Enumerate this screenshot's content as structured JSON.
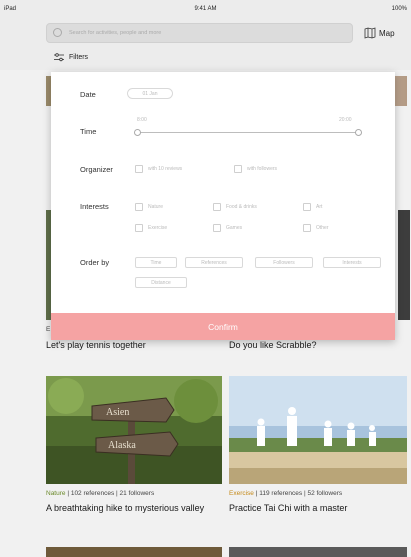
{
  "status_bar": {
    "carrier": "iPad",
    "time": "9:41 AM",
    "battery": "100%"
  },
  "search": {
    "placeholder": "Search for activities, people and more"
  },
  "map_button": {
    "label": "Map",
    "icon": "map-icon"
  },
  "filters_button": {
    "label": "Filters",
    "icon": "sliders-icon"
  },
  "filters": {
    "date": {
      "label": "Date",
      "value": "01 Jan"
    },
    "time": {
      "label": "Time",
      "from": "8:00",
      "to": "20:00"
    },
    "organizer": {
      "label": "Organizer",
      "options": [
        "with 10 reviews",
        "with followers"
      ]
    },
    "interests": {
      "label": "Interests",
      "options": [
        "Nature",
        "Food & drinks",
        "Art",
        "Exercise",
        "Games",
        "Other"
      ]
    },
    "order_by": {
      "label": "Order by",
      "options": [
        "Time",
        "References",
        "Followers",
        "Interests",
        "Distance"
      ]
    },
    "confirm_label": "Confirm"
  },
  "cards": [
    {
      "category": "E",
      "title": "Let's play tennis together"
    },
    {
      "category": "",
      "title": "Do you like Scrabble?"
    },
    {
      "category": "Nature",
      "references": "102 references",
      "followers": "21 followers",
      "title": "A breathtaking hike to mysterious valley",
      "sign_top": "Asien",
      "sign_bottom": "Alaska"
    },
    {
      "category": "Exercise",
      "references": "119 references",
      "followers": "52 followers",
      "title": "Practice Tai Chi with a master"
    }
  ],
  "colors": {
    "confirm": "#f5a3a3",
    "nature": "#6b8a2a",
    "exercise": "#c58a1a"
  }
}
